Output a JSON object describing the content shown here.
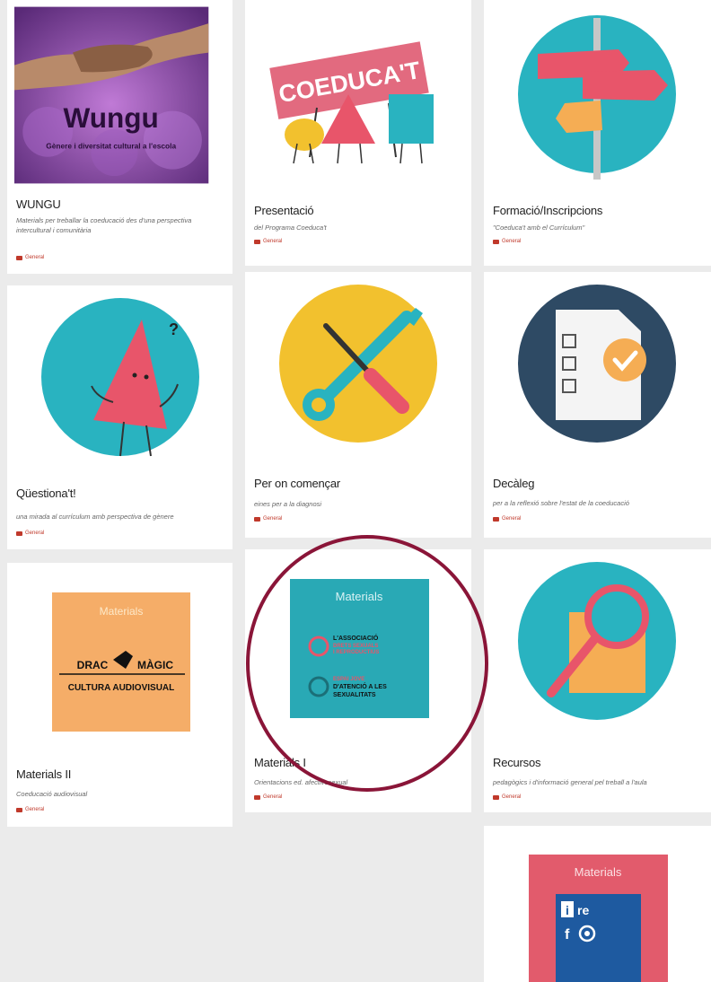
{
  "cards": [
    {
      "key": "wungu",
      "title": "WUNGU",
      "desc": "Materials per treballar la coeducació des d'una perspectiva intercultural i comunitària",
      "category": "General",
      "thumb_title": "Wungu",
      "thumb_subtitle": "Gènere i diversitat cultural a l'escola"
    },
    {
      "key": "presentacio",
      "title": "Presentació",
      "desc": "del Programa Coeduca't",
      "category": "General",
      "thumb_sign": "COEDUCA'T"
    },
    {
      "key": "formacio",
      "title": "Formació/Inscripcions",
      "desc": "\"Coeduca't amb el Currículum\"",
      "category": "General"
    },
    {
      "key": "questionat",
      "title": "Qüestiona't!",
      "desc": "una mirada al currículum amb perspectiva de gènere",
      "category": "General"
    },
    {
      "key": "peron",
      "title": "Per on començar",
      "desc": "eines per a la diagnosi",
      "category": "General"
    },
    {
      "key": "decaleg",
      "title": "Decàleg",
      "desc": "per a la reflexió sobre l'estat de la coeducació",
      "category": "General"
    },
    {
      "key": "materials2",
      "title": "Materials II",
      "desc": "Coeducació audiovisual",
      "category": "General",
      "thumb_label": "Materials",
      "thumb_brand_left": "DRAC",
      "thumb_brand_right": "MÀGIC",
      "thumb_brand_sub": "CULTURA AUDIOVISUAL"
    },
    {
      "key": "materials1",
      "title": "Materials I",
      "desc": "Orientacions ed. afectivosexual",
      "category": "General",
      "thumb_label": "Materials",
      "thumb_line1a": "L'ASSOCIACIÓ",
      "thumb_line1b": "DRETS SEXUALS",
      "thumb_line1c": "I REPRODUCTIUS",
      "thumb_line2a": "ESPAI JOVE",
      "thumb_line2b": "D'ATENCIÓ A LES",
      "thumb_line2c": "SEXUALITATS"
    },
    {
      "key": "recursos",
      "title": "Recursos",
      "desc": "pedagògics i d'informació general pel treball a l'aula",
      "category": "General"
    },
    {
      "key": "materials3",
      "thumb_label": "Materials",
      "thumb_line1": "i re",
      "thumb_line2": "f"
    }
  ],
  "colors": {
    "teal": "#29b3c0",
    "pink": "#e8556a",
    "yellow": "#f2c12e",
    "orange": "#f5ad54",
    "navy": "#2e4a64",
    "highlight": "#8a1538"
  }
}
